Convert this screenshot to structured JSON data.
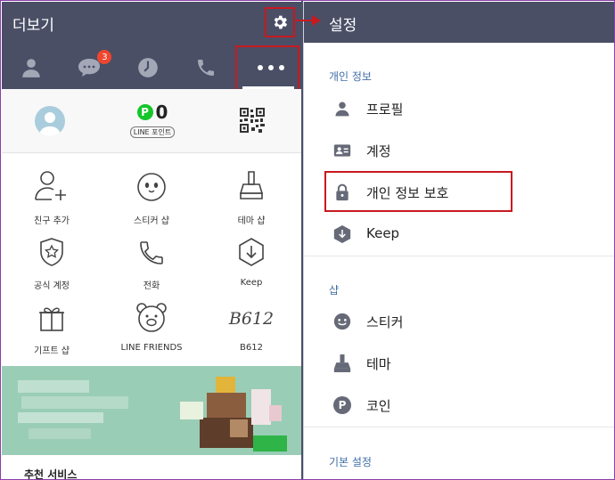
{
  "left": {
    "header_title": "더보기",
    "tabs": [
      {
        "name": "friends-tab",
        "icon": "person-icon"
      },
      {
        "name": "chats-tab",
        "icon": "chat-bubble-icon",
        "badge": "3"
      },
      {
        "name": "timeline-tab",
        "icon": "clock-icon"
      },
      {
        "name": "calls-tab",
        "icon": "phone-icon"
      },
      {
        "name": "more-tab",
        "icon": "more-dots-icon"
      }
    ],
    "profile": {
      "points_value": "0",
      "points_label": "LINE 포인트",
      "p_symbol": "P"
    },
    "grid": [
      {
        "label": "친구 추가",
        "icon": "add-friend-icon"
      },
      {
        "label": "스티커 샵",
        "icon": "sticker-shop-icon"
      },
      {
        "label": "테마 샵",
        "icon": "theme-shop-icon"
      },
      {
        "label": "공식 계정",
        "icon": "official-account-icon"
      },
      {
        "label": "전화",
        "icon": "call-icon"
      },
      {
        "label": "Keep",
        "icon": "keep-icon"
      },
      {
        "label": "기프트 샵",
        "icon": "gift-shop-icon"
      },
      {
        "label": "LINE FRIENDS",
        "icon": "line-friends-icon"
      },
      {
        "label": "B612",
        "icon": "b612-icon",
        "icon_text": "B612"
      }
    ],
    "recommend_title": "추천 서비스",
    "colors": {
      "header": "#4a4f66",
      "banner": "#9acdb6",
      "badge": "#f0462e",
      "point_green": "#13c629",
      "highlight": "#c8191e"
    }
  },
  "right": {
    "header_title": "설정",
    "sections": [
      {
        "title": "개인 정보",
        "items": [
          {
            "label": "프로필",
            "icon": "profile-icon"
          },
          {
            "label": "계정",
            "icon": "account-card-icon"
          },
          {
            "label": "개인 정보 보호",
            "icon": "lock-icon"
          },
          {
            "label": "Keep",
            "icon": "keep-hex-icon"
          }
        ]
      },
      {
        "title": "샵",
        "items": [
          {
            "label": "스티커",
            "icon": "smiley-icon"
          },
          {
            "label": "테마",
            "icon": "brush-icon"
          },
          {
            "label": "코인",
            "icon": "coin-icon",
            "icon_text": "P"
          }
        ]
      },
      {
        "title": "기본 설정",
        "items": []
      }
    ],
    "colors": {
      "section_title": "#3f6ea6",
      "icon": "#666a78"
    }
  }
}
